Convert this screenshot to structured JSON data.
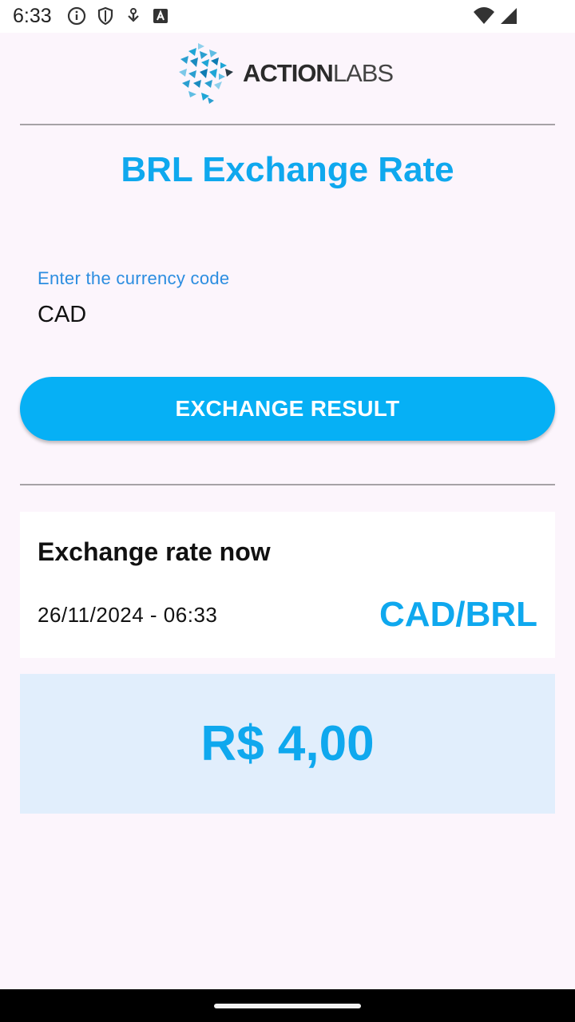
{
  "status_bar": {
    "time": "6:33",
    "icons": [
      "info-icon",
      "shield-icon",
      "download-icon",
      "keyboard-icon",
      "wifi-icon",
      "signal-icon"
    ]
  },
  "logo": {
    "text_bold": "ACTION",
    "text_light": "LABS"
  },
  "page": {
    "title": "BRL Exchange Rate"
  },
  "form": {
    "label": "Enter the currency code",
    "value": "CAD",
    "button_label": "EXCHANGE RESULT"
  },
  "card": {
    "title": "Exchange rate now",
    "datetime": "26/11/2024 - 06:33",
    "pair": "CAD/BRL"
  },
  "result": {
    "value": "R$ 4,00"
  },
  "colors": {
    "accent": "#0fa8ee",
    "button": "#06b0f5",
    "result_bg": "#e1eefc",
    "page_bg": "#fcf5fc"
  }
}
